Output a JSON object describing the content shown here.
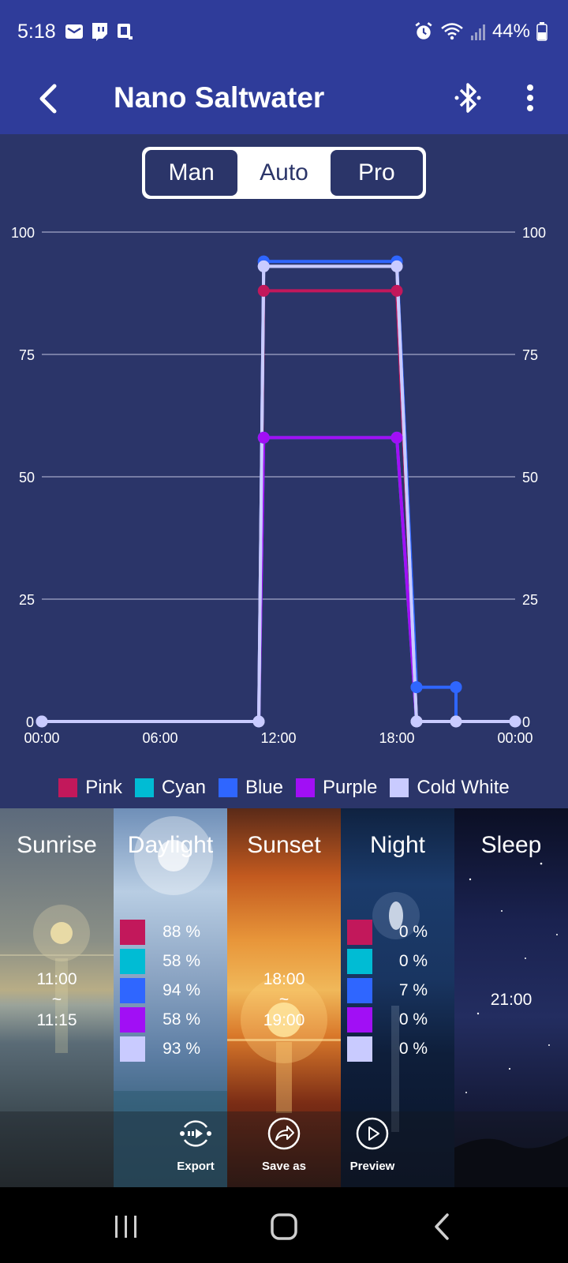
{
  "status_bar": {
    "time": "5:18",
    "battery": "44%"
  },
  "app_bar": {
    "title": "Nano Saltwater"
  },
  "mode_tabs": [
    {
      "label": "Man",
      "active": false
    },
    {
      "label": "Auto",
      "active": true
    },
    {
      "label": "Pro",
      "active": false
    }
  ],
  "chart_data": {
    "type": "line",
    "x_ticks": [
      "00:00",
      "06:00",
      "12:00",
      "18:00",
      "00:00"
    ],
    "y_ticks": [
      "0",
      "25",
      "50",
      "75",
      "100"
    ],
    "ylim": [
      0,
      100
    ],
    "xlim_hours": [
      0,
      24
    ],
    "series": [
      {
        "name": "Pink",
        "color": "#c2185b",
        "x": [
          "00:00",
          "11:00",
          "11:15",
          "18:00",
          "19:00",
          "21:00",
          "24:00"
        ],
        "values": [
          0,
          0,
          88,
          88,
          0,
          0,
          0
        ]
      },
      {
        "name": "Cyan",
        "color": "#00bcd4",
        "x": [
          "00:00",
          "11:00",
          "11:15",
          "18:00",
          "19:00",
          "21:00",
          "24:00"
        ],
        "values": [
          0,
          0,
          58,
          58,
          0,
          0,
          0
        ]
      },
      {
        "name": "Blue",
        "color": "#2f66ff",
        "x": [
          "00:00",
          "11:00",
          "11:15",
          "18:00",
          "19:00",
          "21:00",
          "21:00",
          "24:00"
        ],
        "values": [
          0,
          0,
          94,
          94,
          7,
          7,
          0,
          0
        ]
      },
      {
        "name": "Purple",
        "color": "#a10ff5",
        "x": [
          "00:00",
          "11:00",
          "11:15",
          "18:00",
          "19:00",
          "21:00",
          "24:00"
        ],
        "values": [
          0,
          0,
          58,
          58,
          0,
          0,
          0
        ]
      },
      {
        "name": "Cold White",
        "color": "#c9cbff",
        "x": [
          "00:00",
          "11:00",
          "11:15",
          "18:00",
          "19:00",
          "21:00",
          "24:00"
        ],
        "values": [
          0,
          0,
          93,
          93,
          0,
          0,
          0
        ]
      }
    ]
  },
  "phases": {
    "sunrise": {
      "title": "Sunrise",
      "start": "11:00",
      "sep": "~",
      "end": "11:15"
    },
    "daylight": {
      "title": "Daylight",
      "levels": [
        {
          "color": "#c2185b",
          "value": "88 %"
        },
        {
          "color": "#00bcd4",
          "value": "58 %"
        },
        {
          "color": "#2f66ff",
          "value": "94 %"
        },
        {
          "color": "#a10ff5",
          "value": "58 %"
        },
        {
          "color": "#c9cbff",
          "value": "93 %"
        }
      ]
    },
    "sunset": {
      "title": "Sunset",
      "start": "18:00",
      "sep": "~",
      "end": "19:00"
    },
    "night": {
      "title": "Night",
      "levels": [
        {
          "color": "#c2185b",
          "value": "0 %"
        },
        {
          "color": "#00bcd4",
          "value": "0 %"
        },
        {
          "color": "#2f66ff",
          "value": "7 %"
        },
        {
          "color": "#a10ff5",
          "value": "0 %"
        },
        {
          "color": "#c9cbff",
          "value": "0 %"
        }
      ]
    },
    "sleep": {
      "title": "Sleep",
      "time": "21:00"
    }
  },
  "actions": {
    "export": "Export",
    "save_as": "Save as",
    "preview": "Preview"
  },
  "icons": {
    "back": "back-arrow-icon",
    "bluetooth": "bluetooth-icon",
    "more": "more-vert-icon"
  }
}
